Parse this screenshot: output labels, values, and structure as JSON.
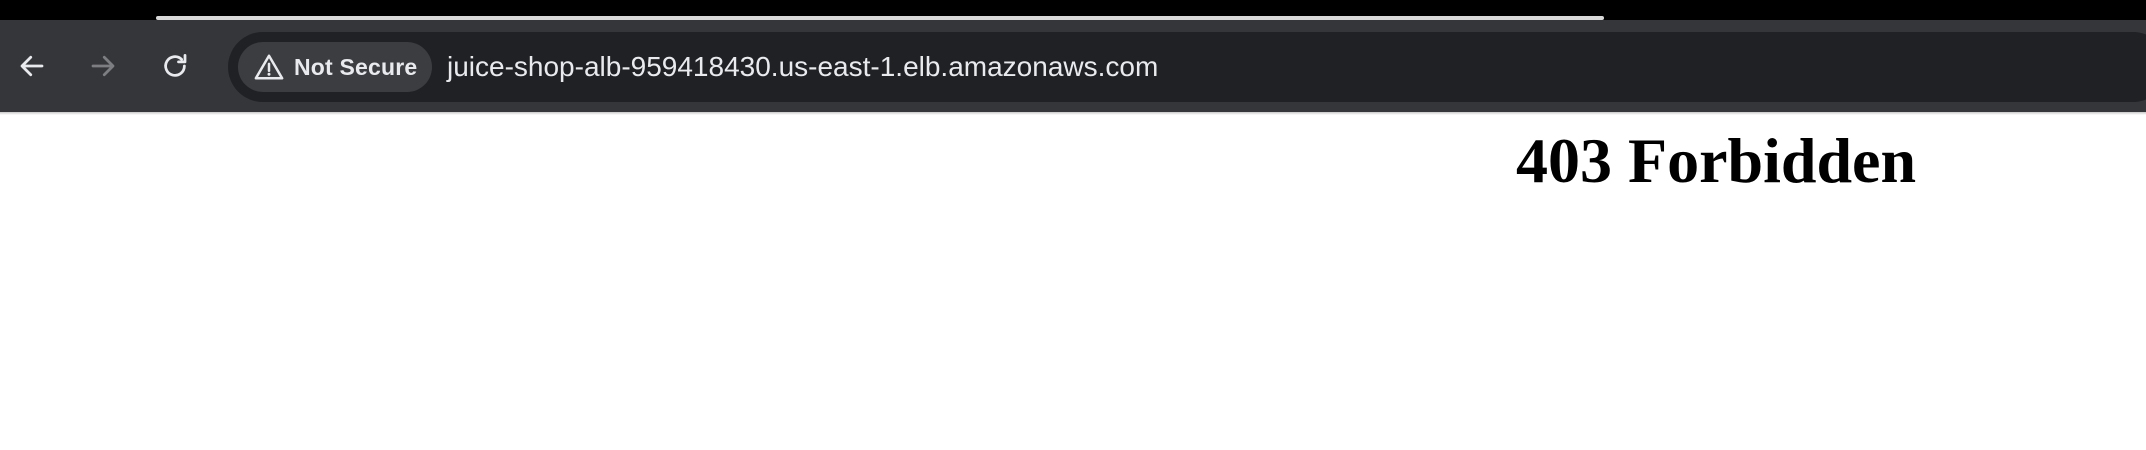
{
  "browser": {
    "tab_strip": {
      "loading_indicator_color": "#d9d9d9"
    },
    "toolbar": {
      "back_icon": "arrow-left-icon",
      "forward_icon": "arrow-right-icon",
      "reload_icon": "reload-icon",
      "background_color": "#35363a"
    },
    "omnibox": {
      "security_icon": "warning-triangle-icon",
      "security_label": "Not Secure",
      "url": "juice-shop-alb-959418430.us-east-1.elb.amazonaws.com",
      "background_color": "#202124",
      "text_color": "#e8eaed"
    }
  },
  "page": {
    "heading": "403 Forbidden"
  }
}
